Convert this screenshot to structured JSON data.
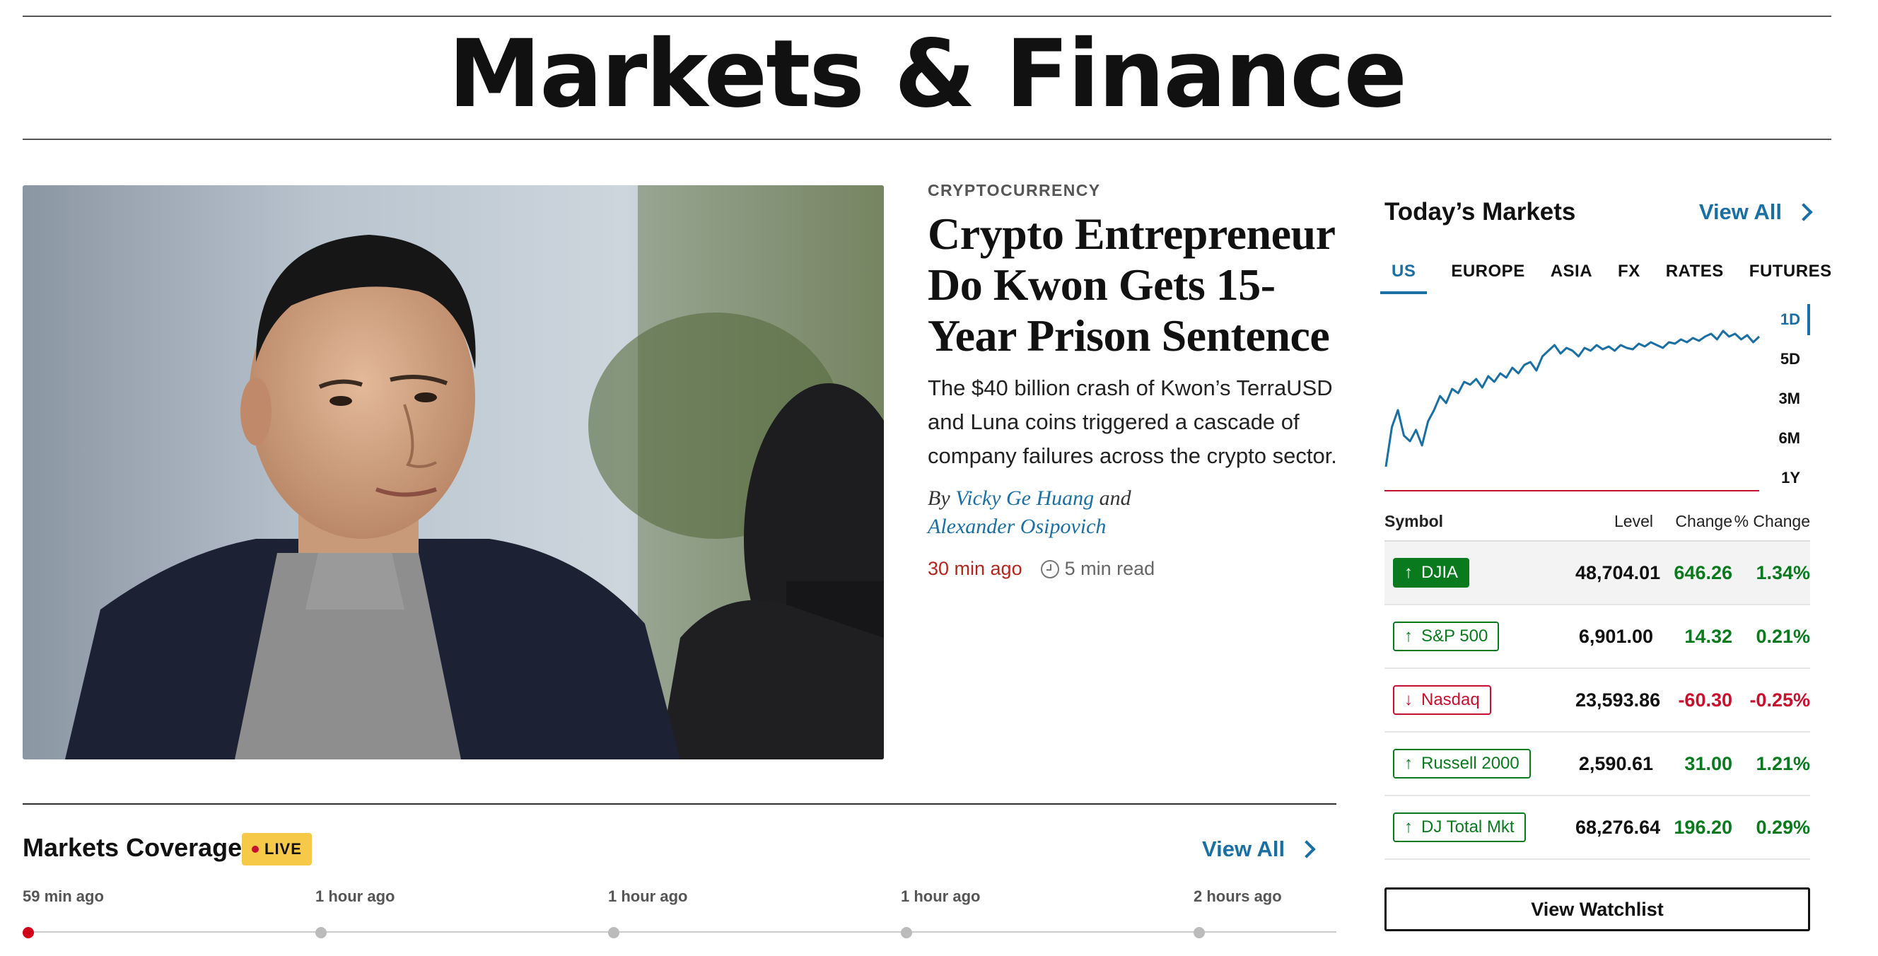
{
  "page": {
    "title": "Markets & Finance"
  },
  "story": {
    "kicker": "CRYPTOCURRENCY",
    "headline": "Crypto Entrepreneur Do Kwon Gets 15-Year Prison Sentence",
    "summary": "The $40 billion crash of Kwon’s TerraUSD and Luna coins triggered a cascade of company failures across the crypto sector.",
    "byline_prefix": "By",
    "author_1": "Vicky Ge Huang",
    "byline_join": "and",
    "author_2": "Alexander Osipovich",
    "time": "30 min ago",
    "read_time": "5 min read"
  },
  "coverage": {
    "title": "Markets Coverage",
    "live_label": "LIVE",
    "view_all": "View All",
    "timeline": [
      "59 min ago",
      "1 hour ago",
      "1 hour ago",
      "1 hour ago",
      "2 hours ago"
    ]
  },
  "markets": {
    "title": "Today’s Markets",
    "view_all": "View All",
    "tabs": [
      "US",
      "EUROPE",
      "ASIA",
      "FX",
      "RATES",
      "FUTURES"
    ],
    "active_tab": "US",
    "ranges": [
      "1D",
      "5D",
      "3M",
      "6M",
      "1Y"
    ],
    "active_range": "1D",
    "columns": {
      "symbol": "Symbol",
      "level": "Level",
      "change": "Change",
      "pct": "% Change"
    },
    "rows": [
      {
        "symbol": "DJIA",
        "level": "48,704.01",
        "change": "646.26",
        "pct": "1.34%",
        "direction": "up"
      },
      {
        "symbol": "S&P 500",
        "level": "6,901.00",
        "change": "14.32",
        "pct": "0.21%",
        "direction": "up"
      },
      {
        "symbol": "Nasdaq",
        "level": "23,593.86",
        "change": "-60.30",
        "pct": "-0.25%",
        "direction": "down"
      },
      {
        "symbol": "Russell 2000",
        "level": "2,590.61",
        "change": "31.00",
        "pct": "1.21%",
        "direction": "up"
      },
      {
        "symbol": "DJ Total Mkt",
        "level": "68,276.64",
        "change": "196.20",
        "pct": "0.29%",
        "direction": "up"
      }
    ],
    "watchlist": "View Watchlist",
    "colors": {
      "up": "#0a7a1f",
      "down": "#c8102e",
      "accent": "#1a6fa3",
      "line": "#1a6fa3",
      "baseline": "#c8102e"
    }
  },
  "chart_data": {
    "type": "line",
    "title": "",
    "xlabel": "",
    "ylabel": "",
    "series": [
      {
        "values": [
          0.0,
          0.28,
          0.4,
          0.22,
          0.18,
          0.26,
          0.15,
          0.32,
          0.4,
          0.5,
          0.45,
          0.55,
          0.52,
          0.6,
          0.58,
          0.62,
          0.56,
          0.64,
          0.6,
          0.66,
          0.63,
          0.7,
          0.66,
          0.72,
          0.74,
          0.68,
          0.78,
          0.82,
          0.86,
          0.8,
          0.84,
          0.82,
          0.78,
          0.84,
          0.82,
          0.86,
          0.83,
          0.85,
          0.82,
          0.86,
          0.84,
          0.83,
          0.87,
          0.85,
          0.88,
          0.86,
          0.84,
          0.88,
          0.87,
          0.9,
          0.88,
          0.91,
          0.89,
          0.92,
          0.94,
          0.9,
          0.96,
          0.92,
          0.94,
          0.9,
          0.93,
          0.88,
          0.92
        ]
      }
    ],
    "ylim": [
      0,
      1
    ],
    "grid": false
  }
}
